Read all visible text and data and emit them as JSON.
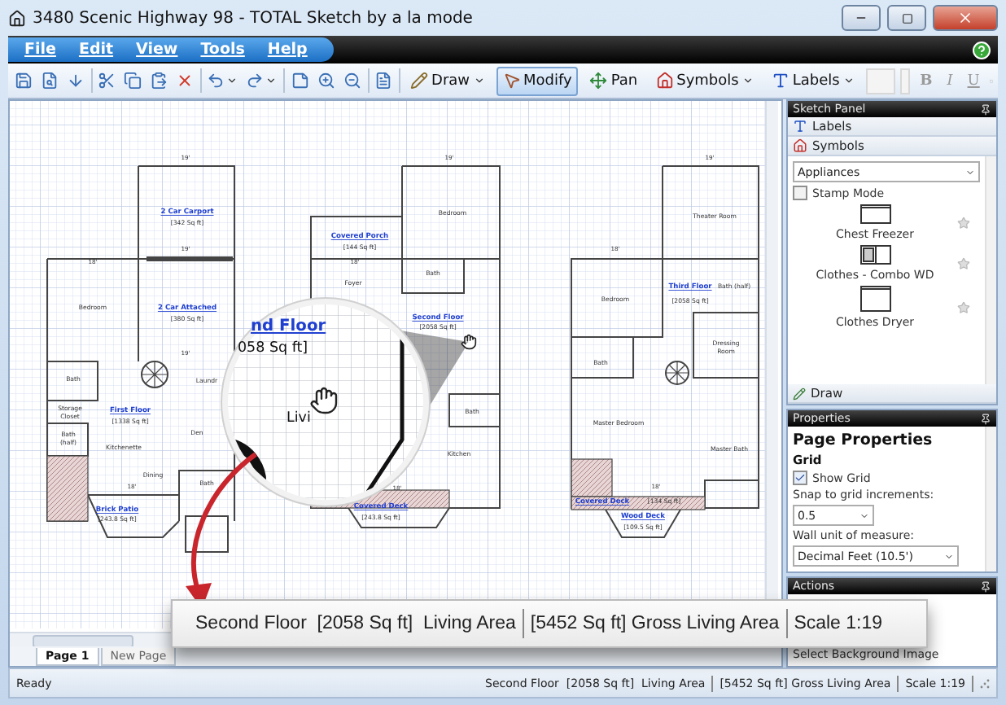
{
  "window": {
    "title": "3480 Scenic Highway 98 - TOTAL Sketch by a la mode"
  },
  "menu": [
    {
      "label": "File"
    },
    {
      "label": "Edit"
    },
    {
      "label": "View"
    },
    {
      "label": "Tools"
    },
    {
      "label": "Help"
    }
  ],
  "toolbar": {
    "tools": [
      {
        "label": "Draw",
        "selected": false,
        "dropdown": true
      },
      {
        "label": "Modify",
        "selected": true,
        "dropdown": false
      },
      {
        "label": "Pan",
        "selected": false,
        "dropdown": false
      },
      {
        "label": "Symbols",
        "selected": false,
        "dropdown": true
      },
      {
        "label": "Labels",
        "selected": false,
        "dropdown": true
      }
    ],
    "format": [
      "B",
      "I",
      "U"
    ]
  },
  "plan_labels": [
    {
      "text": "19'",
      "kind": "dimension"
    },
    {
      "text": "2 Car Carport",
      "kind": "name"
    },
    {
      "text": "[342 Sq ft]",
      "kind": "size"
    },
    {
      "text": "19'",
      "kind": "dimension"
    },
    {
      "text": "18'",
      "kind": "dimension"
    },
    {
      "text": "Bedroom",
      "kind": "room"
    },
    {
      "text": "2 Car Attached",
      "kind": "name"
    },
    {
      "text": "[380 Sq ft]",
      "kind": "size"
    },
    {
      "text": "19'",
      "kind": "dimension"
    },
    {
      "text": "Bath",
      "kind": "room"
    },
    {
      "text": "Laundr",
      "kind": "room"
    },
    {
      "text": "Storage",
      "kind": "room"
    },
    {
      "text": "Closet",
      "kind": "room"
    },
    {
      "text": "First Floor",
      "kind": "name"
    },
    {
      "text": "[1338 Sq ft]",
      "kind": "size"
    },
    {
      "text": "Bath",
      "kind": "room"
    },
    {
      "text": "(half)",
      "kind": "room"
    },
    {
      "text": "Den",
      "kind": "room"
    },
    {
      "text": "Kitchenette",
      "kind": "room"
    },
    {
      "text": "Dining",
      "kind": "room"
    },
    {
      "text": "Bath",
      "kind": "room"
    },
    {
      "text": "18'",
      "kind": "dimension"
    },
    {
      "text": "Brick Patio",
      "kind": "name"
    },
    {
      "text": "[243.8 Sq ft]",
      "kind": "size"
    },
    {
      "text": "19'",
      "kind": "dimension"
    },
    {
      "text": "Bedroom",
      "kind": "room"
    },
    {
      "text": "Covered Porch",
      "kind": "name"
    },
    {
      "text": "[144 Sq ft]",
      "kind": "size"
    },
    {
      "text": "18'",
      "kind": "dimension"
    },
    {
      "text": "Bath",
      "kind": "room"
    },
    {
      "text": "Foyer",
      "kind": "room"
    },
    {
      "text": "Second Floor",
      "kind": "name"
    },
    {
      "text": "[2058 Sq ft]",
      "kind": "size"
    },
    {
      "text": "Bath",
      "kind": "room"
    },
    {
      "text": "Kitchen",
      "kind": "room"
    },
    {
      "text": "18'",
      "kind": "dimension"
    },
    {
      "text": "Covered Deck",
      "kind": "name"
    },
    {
      "text": "[243.8 Sq ft]",
      "kind": "size"
    },
    {
      "text": "19'",
      "kind": "dimension"
    },
    {
      "text": "Theater Room",
      "kind": "room"
    },
    {
      "text": "18'",
      "kind": "dimension"
    },
    {
      "text": "Bedroom",
      "kind": "room"
    },
    {
      "text": "Third Floor",
      "kind": "name"
    },
    {
      "text": "Bath (half)",
      "kind": "room"
    },
    {
      "text": "[2058 Sq ft]",
      "kind": "size"
    },
    {
      "text": "Dressing",
      "kind": "room"
    },
    {
      "text": "Room",
      "kind": "room"
    },
    {
      "text": "Bath",
      "kind": "room"
    },
    {
      "text": "Master Bedroom",
      "kind": "room"
    },
    {
      "text": "Master Bath",
      "kind": "room"
    },
    {
      "text": "18'",
      "kind": "dimension"
    },
    {
      "text": "Covered Deck",
      "kind": "name"
    },
    {
      "text": "[134 Sq ft]",
      "kind": "size"
    },
    {
      "text": "Wood Deck",
      "kind": "name"
    },
    {
      "text": "[109.5 Sq ft]",
      "kind": "size"
    }
  ],
  "magnifier": {
    "labels": [
      {
        "text": "nd Floor",
        "kind": "name"
      },
      {
        "text": "058 Sq ft]",
        "kind": "size"
      },
      {
        "text": "Livi",
        "kind": "room"
      }
    ]
  },
  "callout": {
    "parts": [
      "Second Floor  [2058 Sq ft]  Living Area",
      "[5452 Sq ft] Gross Living Area",
      "Scale 1:19"
    ]
  },
  "page_tabs": [
    {
      "label": "Page 1",
      "selected": true
    },
    {
      "label": "New Page",
      "selected": false
    }
  ],
  "sketch_panel": {
    "title": "Sketch Panel",
    "sections": [
      {
        "label": "Labels",
        "kind": "labels"
      },
      {
        "label": "Symbols",
        "kind": "symbols"
      }
    ],
    "category": "Appliances",
    "stamp_mode": {
      "label": "Stamp Mode",
      "checked": false
    },
    "symbols": [
      {
        "label": "Chest Freezer",
        "kind": "freezer"
      },
      {
        "label": "Clothes - Combo WD",
        "kind": "combo"
      },
      {
        "label": "Clothes Dryer",
        "kind": "dryer"
      }
    ],
    "footer": "Draw"
  },
  "properties": {
    "title": "Properties",
    "heading": "Page Properties",
    "group": "Grid",
    "show_grid": {
      "label": "Show Grid",
      "checked": true
    },
    "snap_label": "Snap to grid increments:",
    "snap_value": "0.5",
    "wall_label": "Wall unit of measure:",
    "wall_value": "Decimal Feet (10.5')"
  },
  "actions": {
    "title": "Actions",
    "items": [
      "Select Background Image"
    ]
  },
  "status_bar": {
    "state": "Ready",
    "parts": [
      "Second Floor  [2058 Sq ft]  Living Area",
      "[5452 Sq ft] Gross Living Area",
      "Scale 1:19"
    ]
  }
}
